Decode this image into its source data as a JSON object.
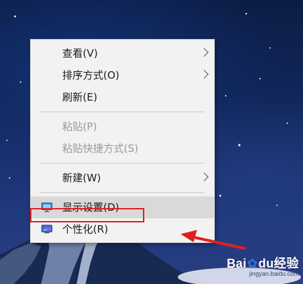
{
  "context_menu": {
    "items": [
      {
        "label": "查看(V)",
        "submenu": true,
        "disabled": false
      },
      {
        "label": "排序方式(O)",
        "submenu": true,
        "disabled": false
      },
      {
        "label": "刷新(E)",
        "submenu": false,
        "disabled": false
      },
      {
        "label": "粘贴(P)",
        "submenu": false,
        "disabled": true
      },
      {
        "label": "粘贴快捷方式(S)",
        "submenu": false,
        "disabled": true
      },
      {
        "label": "新建(W)",
        "submenu": true,
        "disabled": false
      },
      {
        "label": "显示设置(D)",
        "submenu": false,
        "disabled": false,
        "icon": "display-icon",
        "hovered": true
      },
      {
        "label": "个性化(R)",
        "submenu": false,
        "disabled": false,
        "icon": "personalize-icon",
        "highlighted": true
      }
    ]
  },
  "annotation": {
    "highlight_color": "#e02020",
    "arrow_color": "#e02020"
  },
  "watermark": {
    "logo_prefix": "Bai",
    "logo_paw": "du",
    "logo_suffix": "经验",
    "url": "jingyan.baidu.com"
  }
}
